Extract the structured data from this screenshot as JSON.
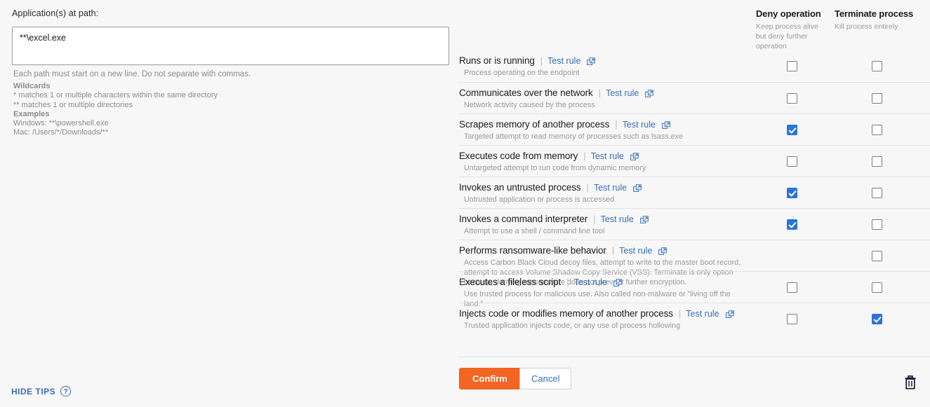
{
  "left": {
    "path_label": "Application(s) at path:",
    "path_value": "**\\excel.exe",
    "path_placeholder": "",
    "helper_note": "Each path must start on a new line. Do not separate with commas.",
    "wildcards_heading": "Wildcards",
    "wildcard_1": "* matches 1 or multiple characters within the same directory",
    "wildcard_2": "** matches 1 or multiple directories",
    "examples_heading": "Examples",
    "example_windows": "Windows: **\\powershell.exe",
    "example_mac": "Mac: /Users/*/Downloads/**",
    "hide_tips_label": "HIDE TIPS",
    "help_icon_glyph": "?"
  },
  "columns": {
    "deny": {
      "title": "Deny operation",
      "subtitle": "Keep process alive but deny further operation"
    },
    "terminate": {
      "title": "Terminate process",
      "subtitle": "Kill process entirely"
    }
  },
  "test_rule_label": "Test rule",
  "separator_glyph": "|",
  "popout_icon_name": "open-in-new-window-icon",
  "rules": [
    {
      "title": "Runs or is running",
      "desc": "Process operating on the endpoint",
      "deny": {
        "present": true,
        "checked": false
      },
      "terminate": {
        "present": true,
        "checked": false
      }
    },
    {
      "title": "Communicates over the network",
      "desc": "Network activity caused by the process",
      "deny": {
        "present": true,
        "checked": false
      },
      "terminate": {
        "present": true,
        "checked": false
      }
    },
    {
      "title": "Scrapes memory of another process",
      "desc": "Targeted attempt to read memory of processes such as lsass.exe",
      "deny": {
        "present": true,
        "checked": true
      },
      "terminate": {
        "present": true,
        "checked": false
      }
    },
    {
      "title": "Executes code from memory",
      "desc": "Untargeted attempt to run code from dynamic memory",
      "deny": {
        "present": true,
        "checked": false
      },
      "terminate": {
        "present": true,
        "checked": false
      }
    },
    {
      "title": "Invokes an untrusted process",
      "desc": "Untrusted application or process is accessed",
      "deny": {
        "present": true,
        "checked": true
      },
      "terminate": {
        "present": true,
        "checked": false
      }
    },
    {
      "title": "Invokes a command interpreter",
      "desc": "Attempt to use a shell / command line tool",
      "deny": {
        "present": true,
        "checked": true
      },
      "terminate": {
        "present": true,
        "checked": false
      }
    },
    {
      "title": "Performs ransomware-like behavior",
      "desc": "Access Carbon Black Cloud decoy files, attempt to write to the master boot record,\nattempt to access Volume Shadow Copy Service (VSS). Terminate is only option\nbecause denying ransomware does not prevent further encryption.",
      "deny": {
        "present": false,
        "checked": false
      },
      "terminate": {
        "present": true,
        "checked": false
      }
    },
    {
      "title": "Executes a fileless script",
      "desc": "Use trusted process for malicious use. Also called non-malware or “living off the land.”",
      "deny": {
        "present": true,
        "checked": false
      },
      "terminate": {
        "present": true,
        "checked": false
      }
    },
    {
      "title": "Injects code or modifies memory of another process",
      "desc": "Trusted application injects code, or any use of process hollowing",
      "deny": {
        "present": true,
        "checked": false
      },
      "terminate": {
        "present": true,
        "checked": true
      }
    }
  ],
  "footer": {
    "confirm_label": "Confirm",
    "cancel_label": "Cancel",
    "delete_icon_name": "trash-icon"
  },
  "colors": {
    "accent_orange": "#f26522",
    "link_blue": "#3a6eb5",
    "checkbox_blue": "#2a74da",
    "page_bg": "#f7f7f7",
    "muted_text": "#9a9a9a"
  }
}
